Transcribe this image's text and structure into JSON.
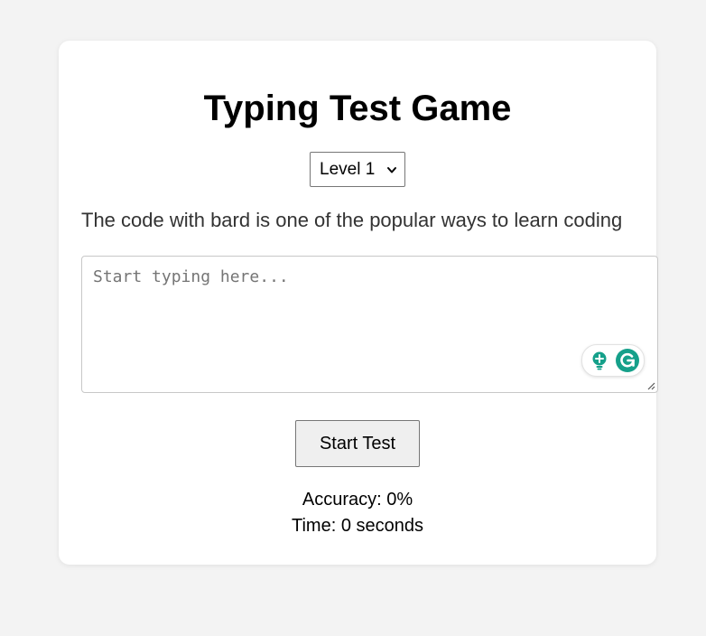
{
  "app": {
    "title": "Typing Test Game"
  },
  "level_select": {
    "selected": "Level 1"
  },
  "sentence": "The code with bard is one of the popular ways to learn coding",
  "typing_input": {
    "value": "",
    "placeholder": "Start typing here..."
  },
  "start_button": {
    "label": "Start Test"
  },
  "stats": {
    "accuracy": "Accuracy: 0%",
    "time": "Time: 0 seconds"
  },
  "extension": {
    "icons": [
      "lightbulb-icon",
      "grammarly-logo-icon"
    ],
    "accent_color": "#15a08a"
  },
  "colors": {
    "page_background": "#f3f3f3",
    "card_background": "#ffffff",
    "sentence_text": "#333333"
  }
}
